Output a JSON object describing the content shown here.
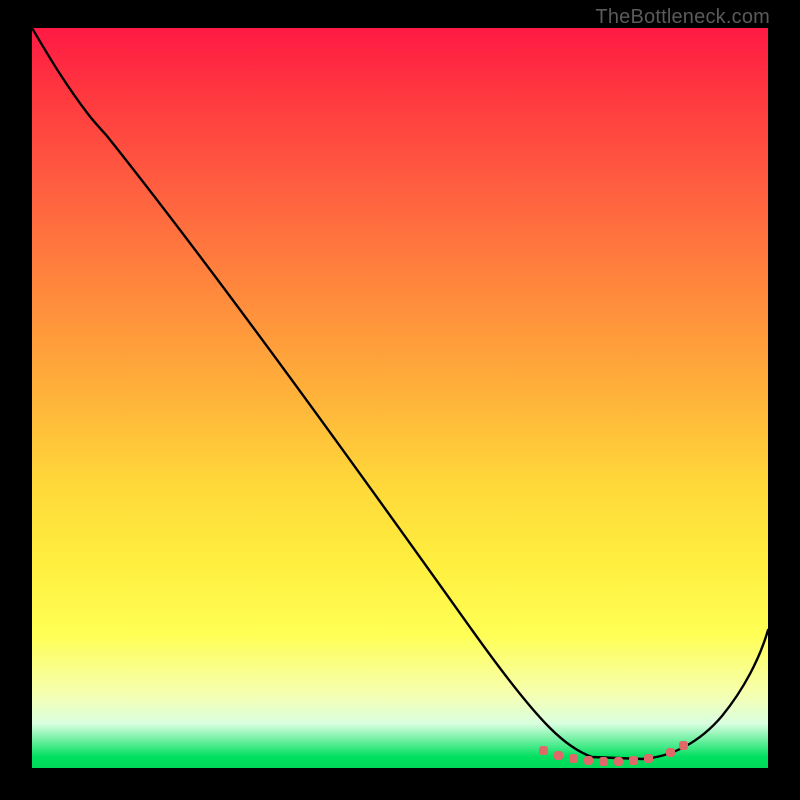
{
  "watermark": "TheBottleneck.com",
  "chart_data": {
    "type": "line",
    "title": "",
    "xlabel": "",
    "ylabel": "",
    "xlim": [
      0,
      100
    ],
    "ylim": [
      0,
      100
    ],
    "grid": false,
    "legend": false,
    "gradient_colors": {
      "top": "#ff1a44",
      "mid": "#ffd93a",
      "low": "#ffff55",
      "bottom": "#00d858"
    },
    "series": [
      {
        "name": "curve",
        "color": "#000000",
        "x": [
          0,
          3.5,
          8,
          14,
          22,
          30,
          38,
          46,
          54,
          58,
          62,
          66,
          70,
          74,
          78,
          82,
          86,
          90,
          94,
          98,
          100
        ],
        "y": [
          100,
          97.5,
          92,
          84,
          73.5,
          62,
          50,
          38,
          26,
          19,
          12.5,
          7,
          3.5,
          1.5,
          0.5,
          0.4,
          1.2,
          4.2,
          9.5,
          16.5,
          21
        ]
      },
      {
        "name": "flat-band-markers",
        "color": "#e86a6a",
        "x": [
          70,
          72,
          74,
          76,
          78,
          80,
          82,
          84,
          86,
          88
        ],
        "y": [
          2.4,
          1.6,
          1.1,
          0.8,
          0.6,
          0.6,
          0.7,
          1.0,
          1.6,
          2.6
        ]
      }
    ],
    "annotations": []
  }
}
